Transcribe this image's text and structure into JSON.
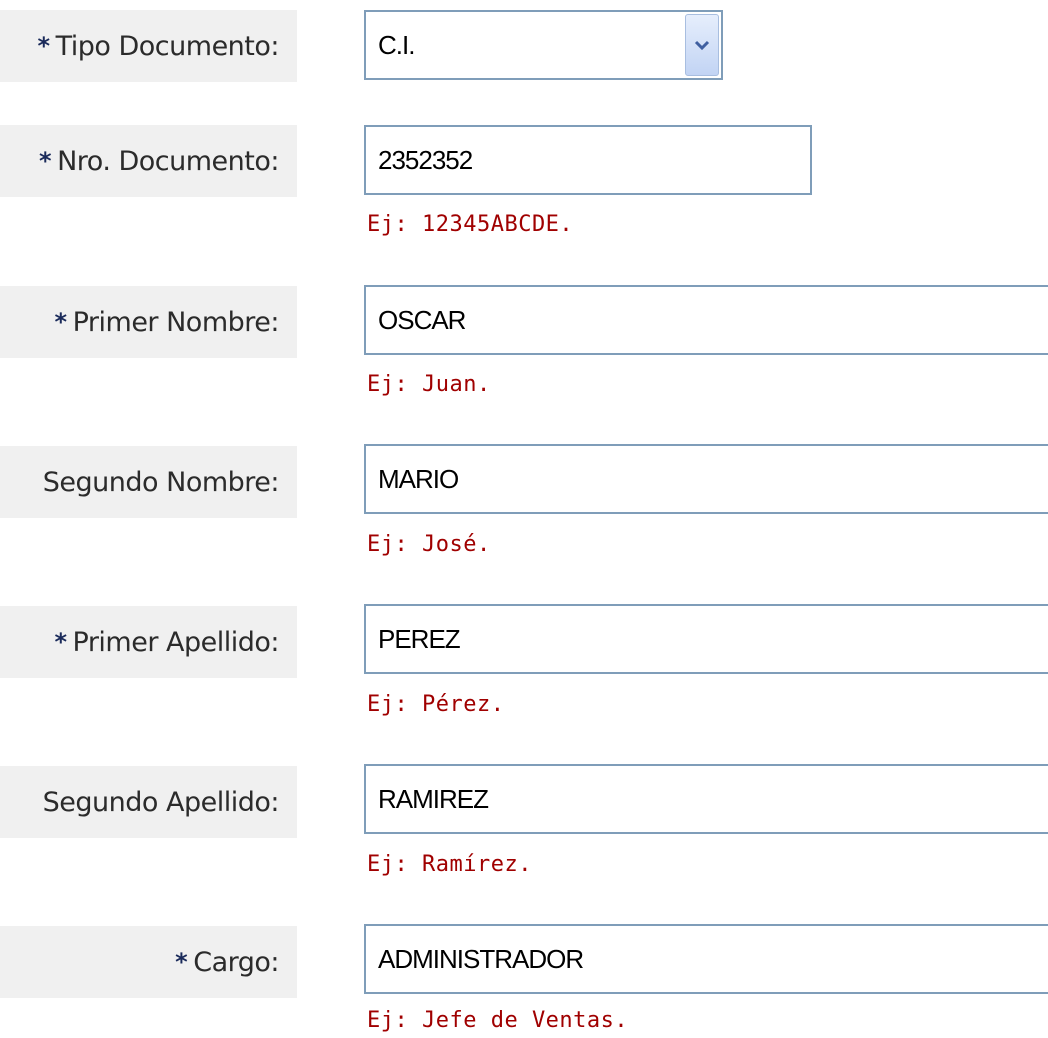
{
  "fields": [
    {
      "label": "Tipo Documento:",
      "required": "*",
      "value": "C.I.",
      "control": "select"
    },
    {
      "label": "Nro. Documento:",
      "required": "*",
      "value": "2352352",
      "hint": "Ej: 12345ABCDE."
    },
    {
      "label": "Primer Nombre:",
      "required": "*",
      "value": "OSCAR",
      "hint": "Ej: Juan."
    },
    {
      "label": "Segundo Nombre:",
      "value": "MARIO",
      "hint": "Ej: José."
    },
    {
      "label": "Primer Apellido:",
      "required": "*",
      "value": "PEREZ",
      "hint": "Ej: Pérez."
    },
    {
      "label": "Segundo Apellido:",
      "value": "RAMIREZ",
      "hint": "Ej: Ramírez."
    },
    {
      "label": "Cargo:",
      "required": "*",
      "value": "ADMINISTRADOR",
      "hint": "Ej: Jefe de Ventas."
    }
  ],
  "icons": {
    "select_arrow": "chevron-down-icon"
  },
  "colors": {
    "label_bg": "#f0f0f0",
    "border": "#7f9db9",
    "hint": "#a00000",
    "required": "#1a2a5a"
  }
}
